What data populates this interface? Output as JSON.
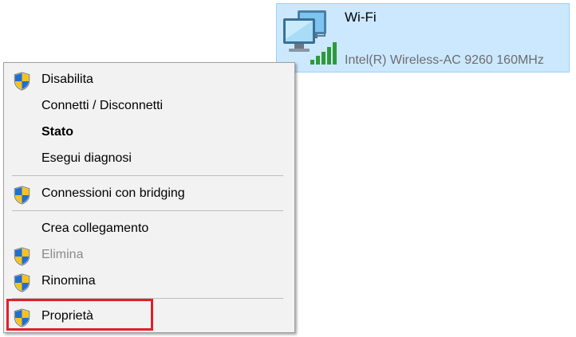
{
  "adapter": {
    "name": "Wi-Fi",
    "device": "Intel(R) Wireless-AC 9260 160MHz",
    "icon": "wifi-network-adapter-icon",
    "selected_bg": "#cce8ff"
  },
  "menu": {
    "items": [
      {
        "label": "Disabilita",
        "shield": true
      },
      {
        "label": "Connetti / Disconnetti",
        "shield": false
      },
      {
        "label": "Stato",
        "shield": false,
        "bold": true
      },
      {
        "label": "Esegui diagnosi",
        "shield": false
      },
      {
        "label": "Connessioni con bridging",
        "shield": true
      },
      {
        "label": "Crea collegamento",
        "shield": false
      },
      {
        "label": "Elimina",
        "shield": true,
        "disabled": true
      },
      {
        "label": "Rinomina",
        "shield": true
      },
      {
        "label": "Proprietà",
        "shield": true,
        "highlighted": true
      }
    ],
    "shield_icon": "uac-shield-icon",
    "highlight_color": "#e0202a"
  }
}
